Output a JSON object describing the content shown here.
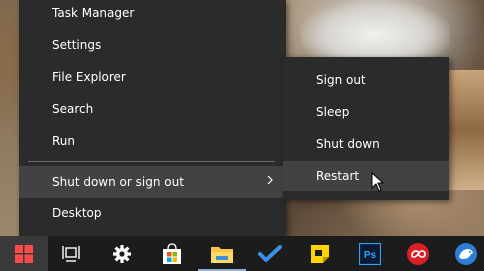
{
  "context_menu": {
    "items": [
      {
        "label": "Task Manager"
      },
      {
        "label": "Settings"
      },
      {
        "label": "File Explorer"
      },
      {
        "label": "Search"
      },
      {
        "label": "Run"
      },
      {
        "label": "Shut down or sign out",
        "has_submenu": true,
        "highlighted": true
      },
      {
        "label": "Desktop"
      }
    ]
  },
  "submenu": {
    "items": [
      {
        "label": "Sign out"
      },
      {
        "label": "Sleep"
      },
      {
        "label": "Shut down"
      },
      {
        "label": "Restart",
        "highlighted": true
      }
    ]
  },
  "taskbar": {
    "icons": [
      {
        "name": "windows-start-icon",
        "active": true
      },
      {
        "name": "task-view-icon"
      },
      {
        "name": "settings-gear-icon"
      },
      {
        "name": "microsoft-store-icon"
      },
      {
        "name": "file-explorer-icon",
        "open": true
      },
      {
        "name": "todo-checkmark-icon"
      },
      {
        "name": "sticky-notes-icon"
      },
      {
        "name": "photoshop-icon",
        "text": "Ps"
      },
      {
        "name": "creative-cloud-icon"
      },
      {
        "name": "bird-app-icon"
      }
    ]
  },
  "colors": {
    "menu_bg": "#2b2b2b",
    "menu_hover": "#424242",
    "taskbar_bg": "#1c1c1c",
    "accent_underline": "#8fb0d8"
  }
}
